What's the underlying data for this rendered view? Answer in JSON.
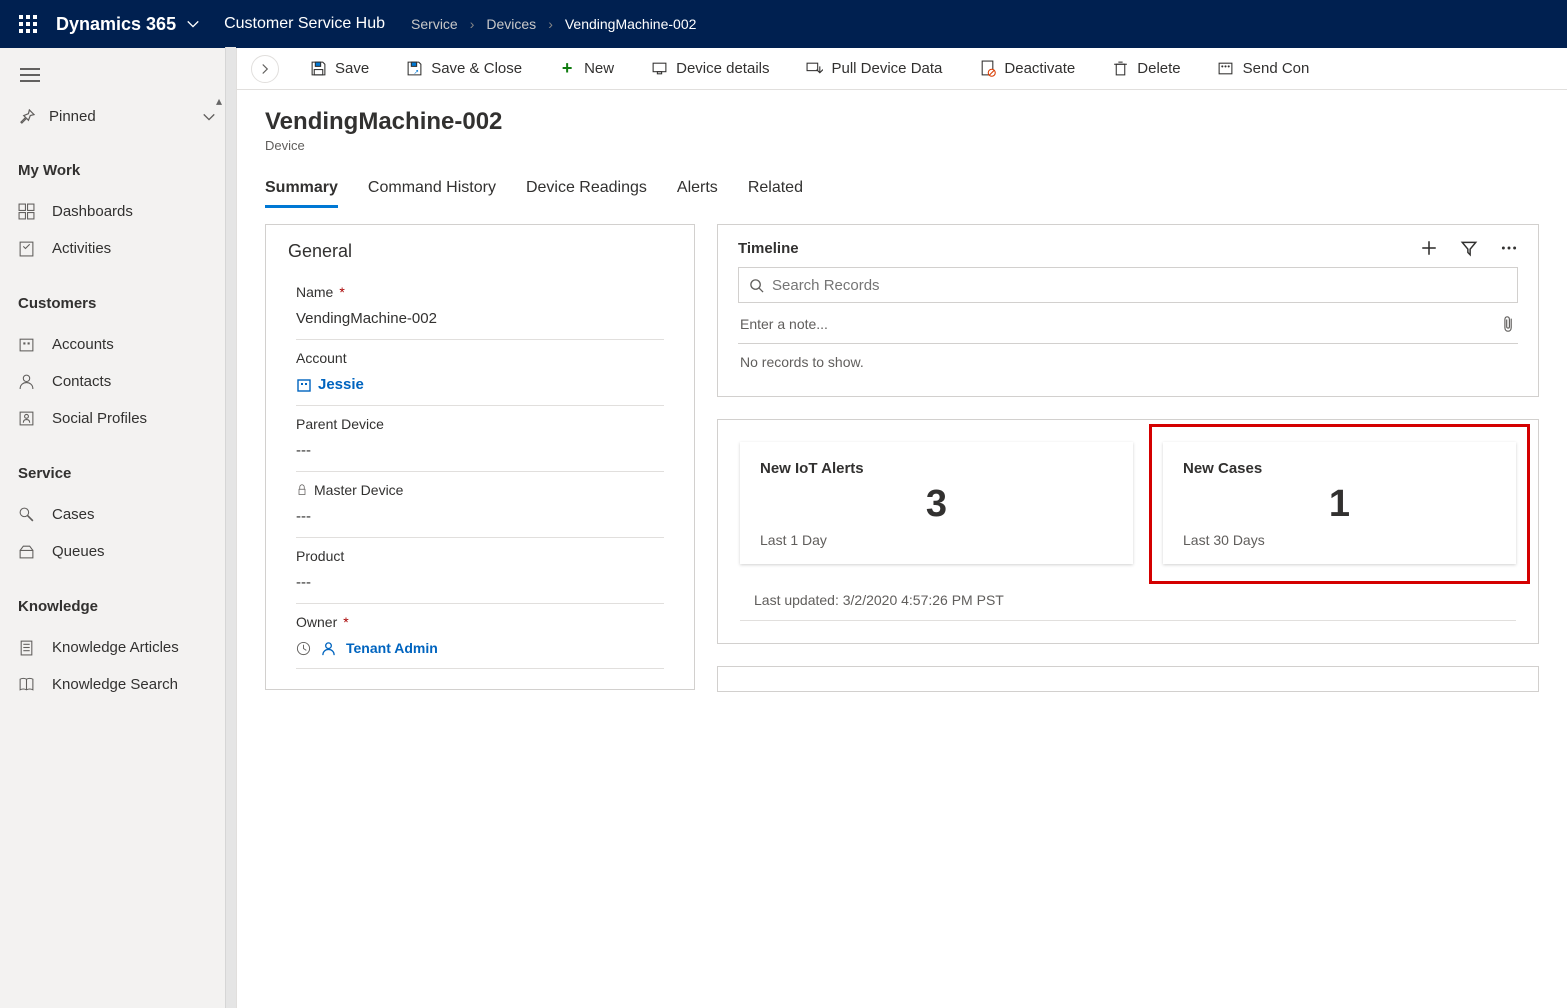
{
  "topnav": {
    "brand": "Dynamics 365",
    "app_name": "Customer Service Hub",
    "breadcrumb": [
      "Service",
      "Devices",
      "VendingMachine-002"
    ]
  },
  "sidebar": {
    "pinned_label": "Pinned",
    "sections": [
      {
        "title": "My Work",
        "items": [
          {
            "icon": "dashboard",
            "label": "Dashboards"
          },
          {
            "icon": "activity",
            "label": "Activities"
          }
        ]
      },
      {
        "title": "Customers",
        "items": [
          {
            "icon": "accounts",
            "label": "Accounts"
          },
          {
            "icon": "contacts",
            "label": "Contacts"
          },
          {
            "icon": "social",
            "label": "Social Profiles"
          }
        ]
      },
      {
        "title": "Service",
        "items": [
          {
            "icon": "cases",
            "label": "Cases"
          },
          {
            "icon": "queues",
            "label": "Queues"
          }
        ]
      },
      {
        "title": "Knowledge",
        "items": [
          {
            "icon": "karticles",
            "label": "Knowledge Articles"
          },
          {
            "icon": "ksearch",
            "label": "Knowledge Search"
          }
        ]
      }
    ]
  },
  "commands": {
    "save": "Save",
    "save_close": "Save & Close",
    "new": "New",
    "device_details": "Device details",
    "pull": "Pull Device Data",
    "deactivate": "Deactivate",
    "delete": "Delete",
    "send": "Send Con"
  },
  "page": {
    "title": "VendingMachine-002",
    "subtitle": "Device",
    "tabs": [
      "Summary",
      "Command History",
      "Device Readings",
      "Alerts",
      "Related"
    ]
  },
  "general": {
    "heading": "General",
    "name_label": "Name",
    "name_value": "VendingMachine-002",
    "account_label": "Account",
    "account_value": "Jessie",
    "parent_label": "Parent Device",
    "parent_value": "---",
    "master_label": "Master Device",
    "master_value": "---",
    "product_label": "Product",
    "product_value": "---",
    "owner_label": "Owner",
    "owner_value": "Tenant Admin"
  },
  "timeline": {
    "heading": "Timeline",
    "search_placeholder": "Search Records",
    "note_placeholder": "Enter a note...",
    "no_records": "No records to show."
  },
  "stats": {
    "card1_title": "New IoT Alerts",
    "card1_value": "3",
    "card1_sub": "Last 1 Day",
    "card2_title": "New Cases",
    "card2_value": "1",
    "card2_sub": "Last 30 Days",
    "last_updated": "Last updated: 3/2/2020 4:57:26 PM PST"
  }
}
